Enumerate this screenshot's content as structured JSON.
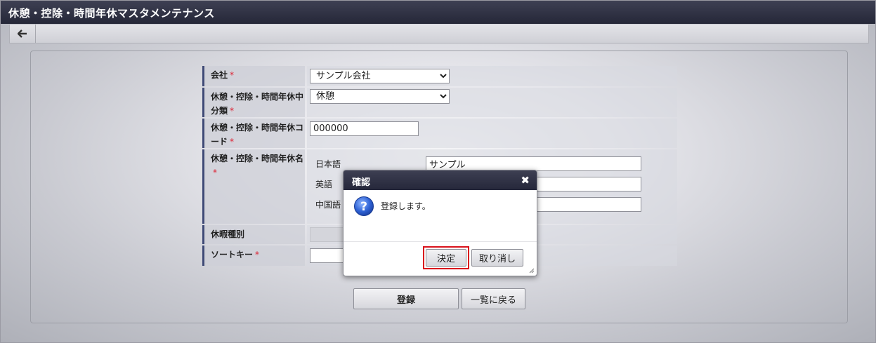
{
  "window": {
    "title": "休憩・控除・時間年休マスタメンテナンス"
  },
  "toolbar": {
    "back_icon": "arrow-left-icon"
  },
  "form": {
    "company": {
      "label": "会社",
      "required_mark": "*",
      "value": "サンプル会社"
    },
    "category": {
      "label": "休憩・控除・時間年休中分類",
      "required_mark": "*",
      "value": "休憩"
    },
    "code": {
      "label": "休憩・控除・時間年休コード",
      "required_mark": "*",
      "value": "000000"
    },
    "name": {
      "label": "休憩・控除・時間年休名",
      "required_mark": "*",
      "languages": [
        {
          "label": "日本語",
          "value": "サンプル"
        },
        {
          "label": "英語",
          "value": ""
        },
        {
          "label": "中国語",
          "value": ""
        }
      ]
    },
    "leave_type": {
      "label": "休暇種別",
      "value": ""
    },
    "sort_key": {
      "label": "ソートキー",
      "required_mark": "*",
      "value": ""
    }
  },
  "actions": {
    "register_label": "登録",
    "back_to_list_label": "一覧に戻る"
  },
  "dialog": {
    "title": "確認",
    "close_icon": "close-icon",
    "message": "登録します。",
    "icon": "question-icon",
    "ok_label": "決定",
    "cancel_label": "取り消し"
  },
  "colors": {
    "header_dark": "#2b2d3f",
    "label_bar": "#3f4a76",
    "required": "#dd2233",
    "highlight": "#d9121c"
  }
}
